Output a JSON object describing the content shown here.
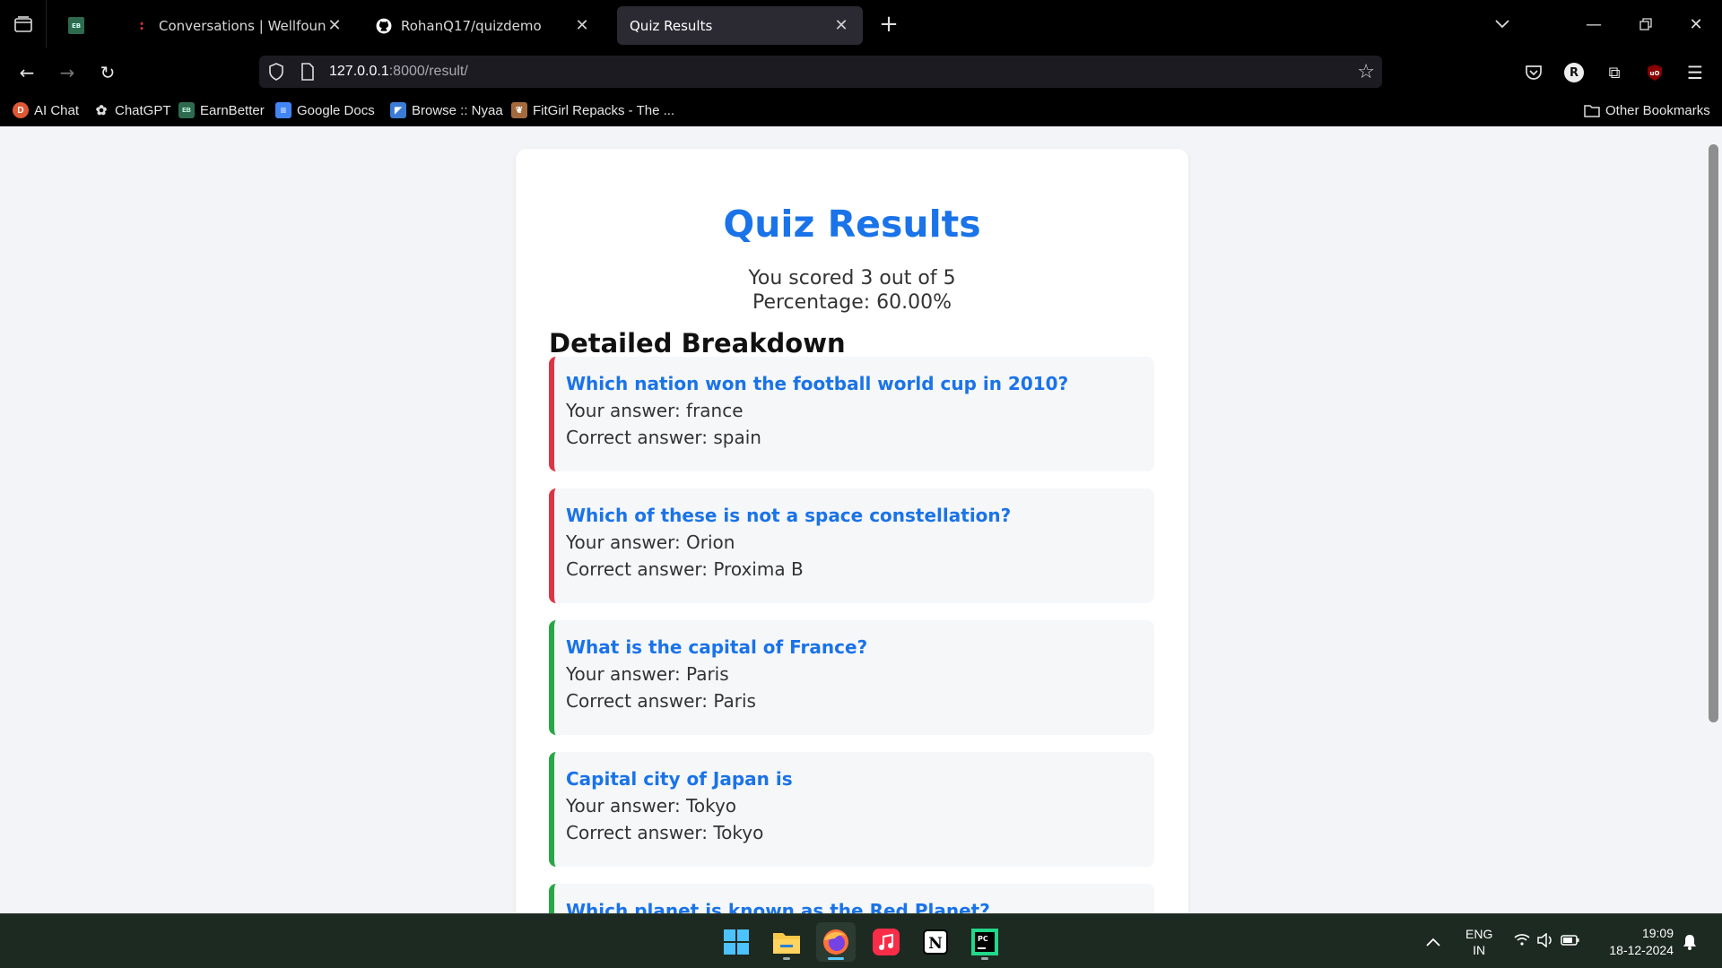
{
  "browser": {
    "tabs": [
      {
        "title": "",
        "favicon": "eb-icon"
      },
      {
        "title": "Conversations | Wellfound",
        "favicon": "wellfound-icon"
      },
      {
        "title": "RohanQ17/quizdemo",
        "favicon": "github-icon"
      },
      {
        "title": "Quiz Results",
        "favicon": "none",
        "active": true
      }
    ],
    "url": {
      "host": "127.0.0.1",
      "rest": ":8000/result/"
    },
    "bookmarks": [
      {
        "label": "AI Chat",
        "icon": "duckduckgo-icon"
      },
      {
        "label": "ChatGPT",
        "icon": "openai-icon"
      },
      {
        "label": "EarnBetter",
        "icon": "eb-icon"
      },
      {
        "label": "Google Docs",
        "icon": "google-docs-icon"
      },
      {
        "label": "Browse :: Nyaa",
        "icon": "nyaa-icon"
      },
      {
        "label": "FitGirl Repacks - The ...",
        "icon": "fitgirl-icon"
      }
    ],
    "other_bookmarks": "Other Bookmarks",
    "profile_initial": "R"
  },
  "page": {
    "title": "Quiz Results",
    "score_line": "You scored 3 out of 5",
    "percentage_line": "Percentage: 60.00%",
    "breakdown_title": "Detailed Breakdown",
    "questions": [
      {
        "question": "Which nation won the football world cup in 2010?",
        "your_answer": "Your answer: france",
        "correct_answer": "Correct answer: spain",
        "correct": false
      },
      {
        "question": "Which of these is not a space constellation?",
        "your_answer": "Your answer: Orion",
        "correct_answer": "Correct answer: Proxima B",
        "correct": false
      },
      {
        "question": "What is the capital of France?",
        "your_answer": "Your answer: Paris",
        "correct_answer": "Correct answer: Paris",
        "correct": true
      },
      {
        "question": "Capital city of Japan is",
        "your_answer": "Your answer: Tokyo",
        "correct_answer": "Correct answer: Tokyo",
        "correct": true
      },
      {
        "question": "Which planet is known as the Red Planet?",
        "your_answer": "",
        "correct_answer": "",
        "correct": true
      }
    ]
  },
  "taskbar": {
    "apps": [
      "windows-start-icon",
      "file-explorer-icon",
      "firefox-icon",
      "apple-music-icon",
      "notion-icon",
      "pycharm-icon"
    ],
    "language": "ENG",
    "region": "IN",
    "time": "19:09",
    "date": "18-12-2024"
  },
  "colors": {
    "accent": "#1a73e8",
    "incorrect": "#dc3545",
    "correct": "#28a745"
  }
}
